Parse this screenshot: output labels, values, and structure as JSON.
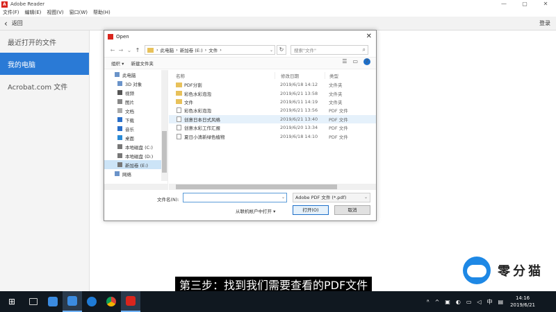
{
  "app": {
    "logo": "A",
    "title": "Adobe Reader",
    "window_controls": [
      "—",
      "▢",
      "✕"
    ]
  },
  "menu": [
    "文件(F)",
    "编辑(E)",
    "视图(V)",
    "窗口(W)",
    "帮助(H)"
  ],
  "toolbar": {
    "back_label": "返回",
    "right_label": "登录"
  },
  "sidebar": {
    "items": [
      {
        "label": "最近打开的文件",
        "active": false
      },
      {
        "label": "我的电脑",
        "active": true
      },
      {
        "label": "Acrobat.com 文件",
        "active": false
      }
    ]
  },
  "dialog": {
    "title": "Open",
    "close": "✕",
    "breadcrumb": [
      "此电脑",
      "›",
      "新加卷 (E:)",
      "›",
      "文件",
      "›"
    ],
    "search_placeholder": "搜索\"文件\"",
    "organize": "组织 ▾",
    "new_folder": "新建文件夹",
    "help": "?",
    "tree": [
      {
        "label": "此电脑",
        "sub": false,
        "selected": false
      },
      {
        "label": "3D 对象",
        "sub": true,
        "selected": false
      },
      {
        "label": "视频",
        "sub": true,
        "selected": false
      },
      {
        "label": "图片",
        "sub": true,
        "selected": false
      },
      {
        "label": "文档",
        "sub": true,
        "selected": false
      },
      {
        "label": "下载",
        "sub": true,
        "selected": false
      },
      {
        "label": "音乐",
        "sub": true,
        "selected": false
      },
      {
        "label": "桌面",
        "sub": true,
        "selected": false
      },
      {
        "label": "本地磁盘 (C:)",
        "sub": true,
        "selected": false
      },
      {
        "label": "本地磁盘 (D:)",
        "sub": true,
        "selected": false
      },
      {
        "label": "新加卷 (E:)",
        "sub": true,
        "selected": true
      },
      {
        "label": "网络",
        "sub": false,
        "selected": false
      }
    ],
    "columns": {
      "name": "名称",
      "date": "修改日期",
      "type": "类型"
    },
    "files": [
      {
        "name": "PDF分割",
        "date": "2019/6/18 14:12",
        "type": "文件夹",
        "kind": "folder",
        "hover": false
      },
      {
        "name": "彩色水彩泡泡",
        "date": "2019/6/21 13:58",
        "type": "文件夹",
        "kind": "folder",
        "hover": false
      },
      {
        "name": "文件",
        "date": "2019/6/11 14:19",
        "type": "文件夹",
        "kind": "folder",
        "hover": false
      },
      {
        "name": "彩色水彩泡泡",
        "date": "2019/6/21 13:56",
        "type": "PDF 文件",
        "kind": "pdf",
        "hover": false
      },
      {
        "name": "创意日本日式风格",
        "date": "2019/6/21 13:40",
        "type": "PDF 文件",
        "kind": "pdf",
        "hover": true
      },
      {
        "name": "创意水彩工作汇报",
        "date": "2019/6/20 13:34",
        "type": "PDF 文件",
        "kind": "pdf",
        "hover": false
      },
      {
        "name": "夏日小清新绿色植物",
        "date": "2019/6/18 14:10",
        "type": "PDF 文件",
        "kind": "pdf",
        "hover": false
      }
    ],
    "filename_label": "文件名(N):",
    "filename_value": "",
    "filetype": "Adobe PDF 文件 (*.pdf)",
    "web_open": "从联机帐户中打开 ▾",
    "open_button": "打开(O)",
    "cancel_button": "取消"
  },
  "watermark": {
    "text": "零分猫"
  },
  "caption": "第三步：找到我们需要查看的PDF文件",
  "taskbar": {
    "start": "⊞",
    "tray_icons": [
      "ᴿ",
      "^",
      "▣",
      "◐",
      "▭",
      "◁",
      "中",
      "▤"
    ],
    "time": "14:16",
    "date": "2019/6/21"
  },
  "colors": {
    "accent": "#2a7ad6",
    "pdf_red": "#d9251d",
    "taskbar": "#101820"
  }
}
